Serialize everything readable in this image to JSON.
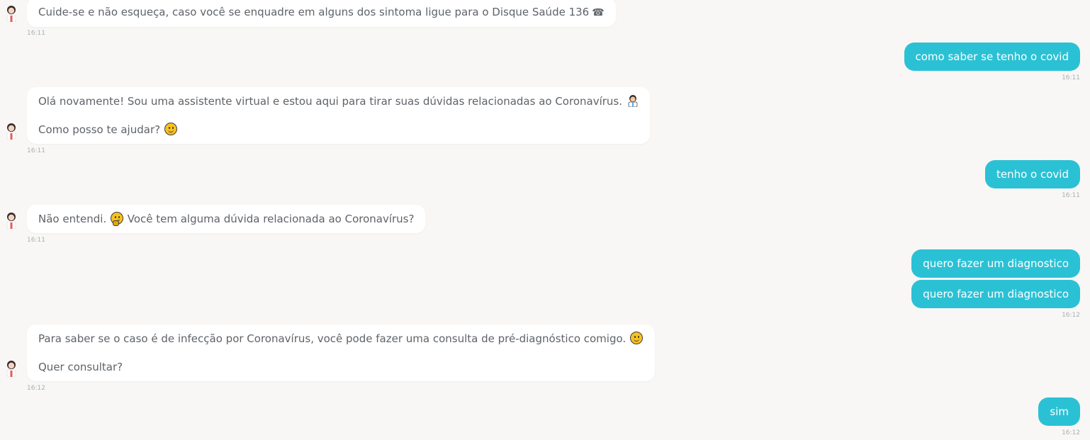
{
  "messages": [
    {
      "sender": "bot",
      "lines": [
        "Cuide-se e não esqueça, caso você se enquadre em alguns dos sintoma ligue para o Disque Saúde 136"
      ],
      "icon": "phone-icon",
      "time": "16:11"
    },
    {
      "sender": "user",
      "text": "como saber se tenho o covid",
      "time": "16:11"
    },
    {
      "sender": "bot",
      "lines": [
        "Olá novamente! Sou uma assistente virtual e estou aqui para tirar suas dúvidas relacionadas ao Coronavírus.",
        "Como posso te ajudar?"
      ],
      "time": "16:11"
    },
    {
      "sender": "user",
      "text": "tenho o covid",
      "time": "16:11"
    },
    {
      "sender": "bot",
      "lines": [
        "Não entendi.",
        "Você tem alguma dúvida relacionada ao Coronavírus?"
      ],
      "time": "16:11"
    },
    {
      "sender": "user",
      "text": "quero fazer um diagnostico"
    },
    {
      "sender": "user",
      "text": "quero fazer um diagnostico",
      "time": "16:12"
    },
    {
      "sender": "bot",
      "lines": [
        "Para saber se o caso é de infecção por Coronavírus, você pode fazer uma consulta de pré-diagnóstico comigo.",
        "Quer consultar?"
      ],
      "time": "16:12"
    },
    {
      "sender": "user",
      "text": "sim",
      "time": "16:12"
    }
  ],
  "icons": {
    "phone": "☎",
    "accent_color": "#2bc1d5",
    "bot_bubble_color": "#ffffff",
    "background_color": "#f8f7f5"
  }
}
